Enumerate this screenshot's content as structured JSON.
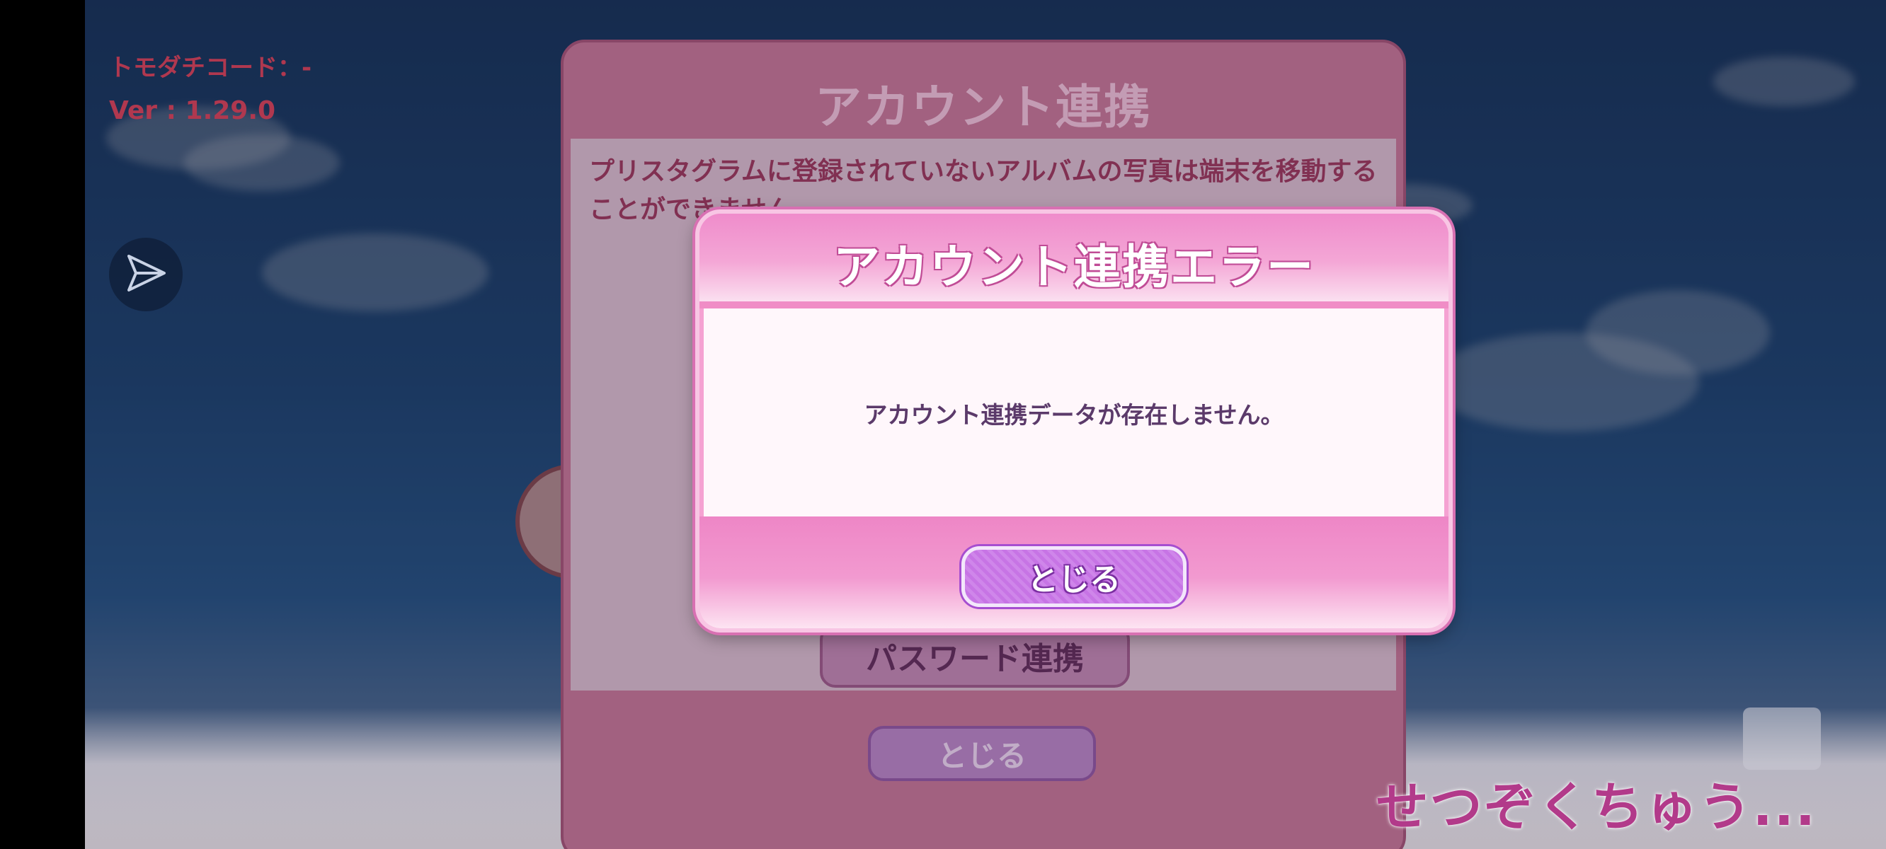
{
  "hud": {
    "friend_code": "トモダチコード：-",
    "version": "Ver : 1.29.0",
    "share_icon": "paper-plane-icon"
  },
  "background_dialog": {
    "title": "アカウント連携",
    "body_line1": "プリスタグラムに登録されていないアルバムの写真は端末を移動する",
    "body_line2": "ことができません。",
    "password_button": "パスワード連携",
    "close_button": "とじる"
  },
  "error_dialog": {
    "title": "アカウント連携エラー",
    "message": "アカウント連携データが存在しません。",
    "close_button": "とじる"
  },
  "status": {
    "connecting": "せつぞくちゅう..."
  },
  "colors": {
    "dialog_pink": "#f5a2d2",
    "title_outline": "#c04c96",
    "button_purple": "#c774e5",
    "message_text": "#5b3a6a",
    "hud_text": "#b0384f"
  }
}
